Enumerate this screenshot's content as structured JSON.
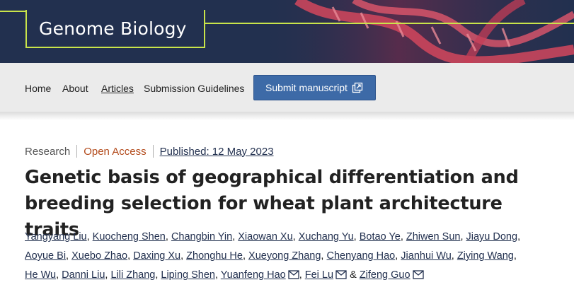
{
  "header": {
    "journal_title": "Genome Biology",
    "brand_accent": "#c9e44a",
    "background": "#22304f"
  },
  "nav": {
    "items": [
      {
        "label": "Home"
      },
      {
        "label": "About"
      },
      {
        "label": "Articles",
        "active": true
      },
      {
        "label": "Submission Guidelines"
      }
    ],
    "submit_label": "Submit manuscript",
    "submit_icon": "external-link-icon",
    "button_color": "#3d6aa7"
  },
  "article": {
    "type": "Research",
    "access": "Open Access",
    "published": "Published: 12 May 2023",
    "title": "Genetic basis of geographical differentiation and breeding selection for wheat plant architecture traits"
  },
  "authors": [
    "Yangyang Liu",
    "Kuocheng Shen",
    "Changbin Yin",
    "Xiaowan Xu",
    "Xuchang Yu",
    "Botao Ye",
    "Zhiwen Sun",
    "Jiayu Dong",
    "Aoyue Bi",
    "Xuebo Zhao",
    "Daxing Xu",
    "Zhonghu He",
    "Xueyong Zhang",
    "Chenyang Hao",
    "Jianhui Wu",
    "Ziying Wang",
    "He Wu",
    "Danni Liu",
    "Lili Zhang",
    "Liping Shen",
    "Yuanfeng Hao",
    "Fei Lu",
    "Zifeng Guo"
  ],
  "author_separator": ",",
  "author_last_separator": "&",
  "corresponding_icon": "mail-icon"
}
